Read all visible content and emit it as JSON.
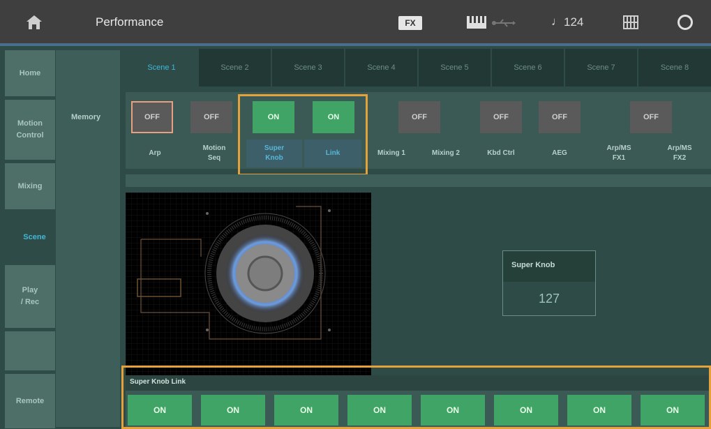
{
  "header": {
    "title": "Performance",
    "fx_badge": "FX",
    "tempo_note": "♩",
    "tempo": "124"
  },
  "sidebar": {
    "items": [
      {
        "label": "Home"
      },
      {
        "label": "Motion\nControl"
      },
      {
        "label": "Mixing"
      },
      {
        "label": "Scene"
      },
      {
        "label": "Play\n/ Rec"
      },
      {
        "label": "Remote"
      }
    ],
    "active": "Scene"
  },
  "subsection": {
    "memory_label": "Memory"
  },
  "tabs": [
    {
      "label": "Scene 1"
    },
    {
      "label": "Scene 2"
    },
    {
      "label": "Scene 3"
    },
    {
      "label": "Scene 4"
    },
    {
      "label": "Scene 5"
    },
    {
      "label": "Scene 6"
    },
    {
      "label": "Scene 7"
    },
    {
      "label": "Scene 8"
    }
  ],
  "memory": {
    "buttons": [
      {
        "label": "OFF",
        "state": "off"
      },
      {
        "label": "OFF",
        "state": "off"
      },
      {
        "label": "ON",
        "state": "on"
      },
      {
        "label": "ON",
        "state": "on"
      },
      {
        "label": "OFF",
        "state": "off"
      },
      {
        "label": "OFF",
        "state": "off"
      },
      {
        "label": "OFF",
        "state": "off"
      },
      {
        "label": "OFF",
        "state": "off"
      }
    ],
    "labels": [
      {
        "text": "Arp"
      },
      {
        "text": "Motion\nSeq"
      },
      {
        "text": "Super\nKnob"
      },
      {
        "text": "Link"
      },
      {
        "text": "Mixing 1"
      },
      {
        "text": "Mixing 2"
      },
      {
        "text": "Kbd Ctrl"
      },
      {
        "text": "AEG"
      },
      {
        "text": "Arp/MS\nFX1"
      },
      {
        "text": "Arp/MS\nFX2"
      }
    ]
  },
  "super_knob": {
    "label": "Super Knob",
    "value": "127"
  },
  "link": {
    "header": "Super Knob Link",
    "buttons": [
      "ON",
      "ON",
      "ON",
      "ON",
      "ON",
      "ON",
      "ON",
      "ON"
    ]
  },
  "colors": {
    "accent": "#40b8d8",
    "on_green": "#3fa466",
    "highlight_orange": "#e5a23a"
  }
}
